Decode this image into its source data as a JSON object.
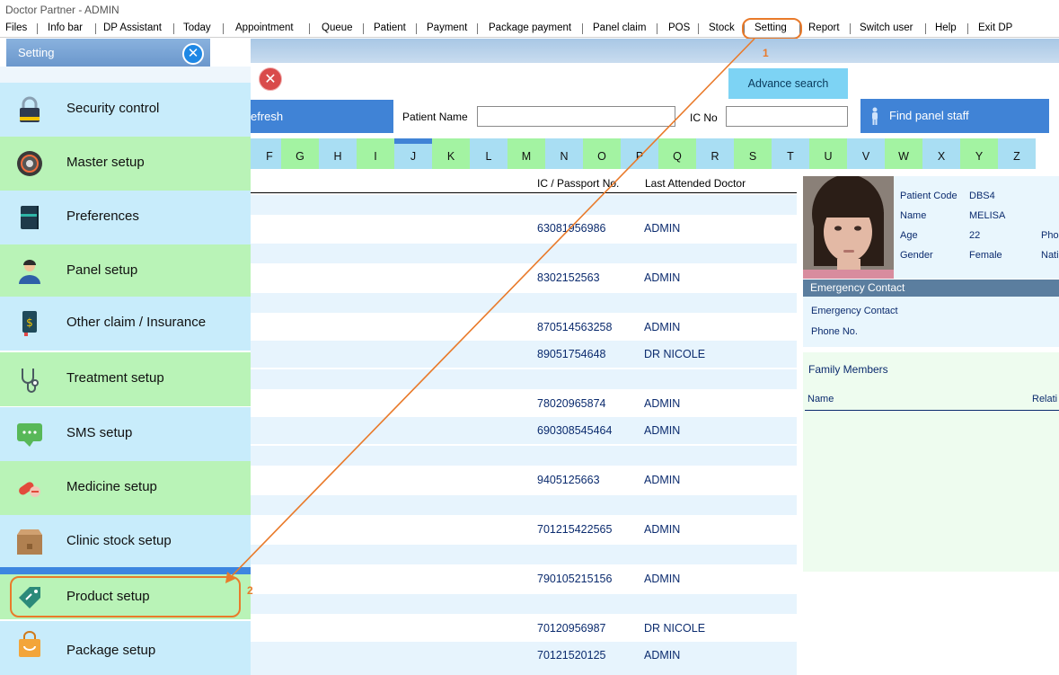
{
  "window": {
    "title": "Doctor Partner - ADMIN"
  },
  "menu": [
    "Files",
    "Info bar",
    "DP Assistant",
    "Today",
    "Appointment",
    "Queue",
    "Patient",
    "Payment",
    "Package payment",
    "Panel claim",
    "POS",
    "Stock",
    "Setting",
    "Report",
    "Switch user",
    "Help",
    "Exit DP"
  ],
  "sidebar": {
    "title": "Setting",
    "items": [
      {
        "label": "Security control",
        "icon": "lock-icon"
      },
      {
        "label": "Master setup",
        "icon": "gear-icon"
      },
      {
        "label": "Preferences",
        "icon": "book-icon"
      },
      {
        "label": "Panel setup",
        "icon": "person-icon"
      },
      {
        "label": "Other claim / Insurance",
        "icon": "money-doc-icon"
      },
      {
        "label": "Treatment setup",
        "icon": "stethoscope-icon"
      },
      {
        "label": "SMS setup",
        "icon": "chat-bubble-icon"
      },
      {
        "label": "Medicine setup",
        "icon": "pills-icon"
      },
      {
        "label": "Clinic stock setup",
        "icon": "box-icon"
      },
      {
        "label": "Product setup",
        "icon": "tag-icon"
      },
      {
        "label": "Package setup",
        "icon": "bag-icon"
      }
    ]
  },
  "search": {
    "advance_search": "Advance search",
    "refresh": "efresh",
    "patient_name_label": "Patient Name",
    "patient_name_value": "",
    "ic_label": "IC No",
    "ic_value": "",
    "find_panel_staff": "Find panel staff"
  },
  "alphabet": [
    "F",
    "G",
    "H",
    "I",
    "J",
    "K",
    "L",
    "M",
    "N",
    "O",
    "P",
    "Q",
    "R",
    "S",
    "T",
    "U",
    "V",
    "W",
    "X",
    "Y",
    "Z"
  ],
  "table": {
    "headers": {
      "ic": "IC / Passport No.",
      "doctor": "Last Attended Doctor"
    },
    "rows": [
      {
        "ic": "63081956986",
        "doctor": "ADMIN"
      },
      {
        "ic": "8302152563",
        "doctor": "ADMIN"
      },
      {
        "ic": "870514563258",
        "doctor": "ADMIN"
      },
      {
        "ic": "89051754648",
        "doctor": "DR NICOLE"
      },
      {
        "ic": "78020965874",
        "doctor": "ADMIN"
      },
      {
        "ic": "690308545464",
        "doctor": "ADMIN"
      },
      {
        "ic": "9405125663",
        "doctor": "ADMIN"
      },
      {
        "ic": "701215422565",
        "doctor": "ADMIN"
      },
      {
        "ic": "790105215156",
        "doctor": "ADMIN"
      },
      {
        "ic": "70120956987",
        "doctor": "DR NICOLE"
      },
      {
        "ic": "70121520125",
        "doctor": "ADMIN"
      }
    ]
  },
  "patient": {
    "code_label": "Patient Code",
    "code": "DBS4",
    "name_label": "Name",
    "name": "MELISA",
    "age_label": "Age",
    "age": "22",
    "gender_label": "Gender",
    "gender": "Female",
    "phone_label_cut": "Pho",
    "nation_label_cut": "Nati"
  },
  "emergency": {
    "header": "Emergency Contact",
    "contact_label": "Emergency Contact",
    "phone_label": "Phone No."
  },
  "family": {
    "title": "Family Members",
    "col_name": "Name",
    "col_relation_cut": "Relati"
  },
  "annotations": {
    "step1": "1",
    "step2": "2"
  },
  "colors": {
    "accent_orange": "#e97a2a",
    "button_blue": "#4083d6",
    "tab_blue": "#a9def3",
    "tab_green": "#a3f3a2"
  }
}
